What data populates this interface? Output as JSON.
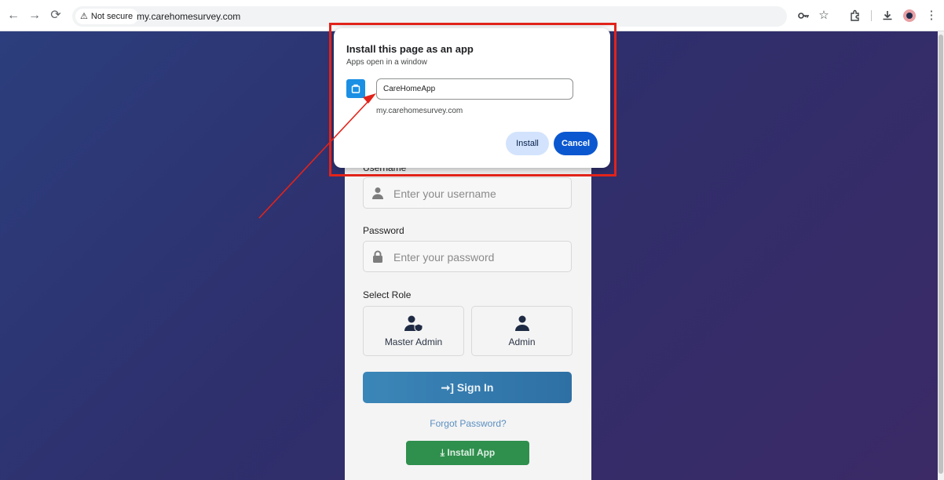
{
  "browser": {
    "security_label": "Not secure",
    "url": "my.carehomesurvey.com"
  },
  "login": {
    "username_label": "Username",
    "username_placeholder": "Enter your username",
    "password_label": "Password",
    "password_placeholder": "Enter your password",
    "role_label": "Select Role",
    "roles": [
      {
        "label": "Master Admin",
        "icon": "user-shield-icon"
      },
      {
        "label": "Admin",
        "icon": "user-icon"
      }
    ],
    "signin_label": "Sign In",
    "forgot_label": "Forgot Password?",
    "install_label": "Install App"
  },
  "dialog": {
    "title": "Install this page as an app",
    "subtitle": "Apps open in a window",
    "app_name": "CareHomeApp",
    "origin": "my.carehomesurvey.com",
    "install_label": "Install",
    "cancel_label": "Cancel"
  },
  "colors": {
    "annotation": "#e2231a",
    "cancel_button": "#0b57d0",
    "signin_button": "#2e70a4",
    "install_app_button": "#2f8f4d"
  }
}
